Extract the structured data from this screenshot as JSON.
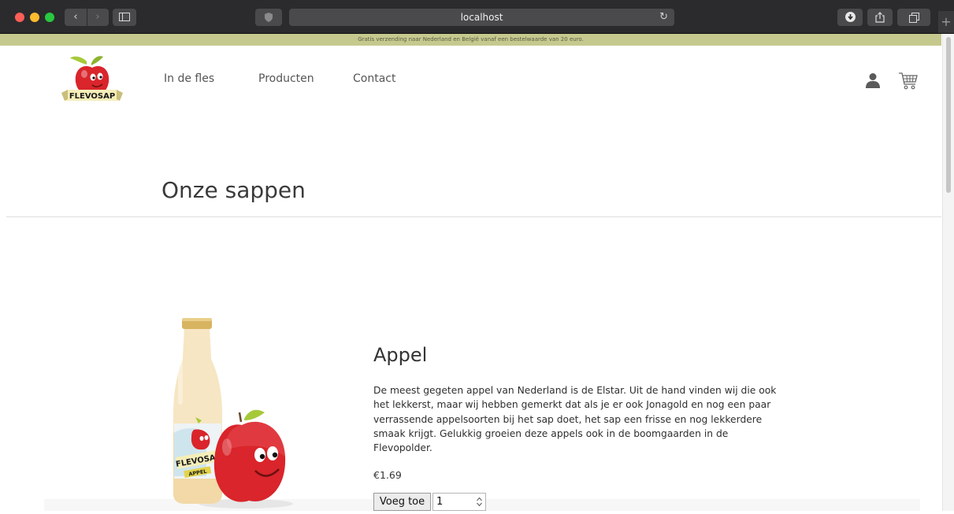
{
  "browser": {
    "url": "localhost",
    "colors": {
      "chrome_bg": "#2b2b2d",
      "close": "#fe5f57",
      "minimize": "#febc2e",
      "zoom": "#28c840"
    }
  },
  "announcement": {
    "text": "Gratis verzending naar Nederland en België vanaf een bestelwaarde van 20 euro.",
    "background": "#c5c98e"
  },
  "header": {
    "logo_text": "FLEVOSAP",
    "nav": [
      "In de fles",
      "Producten",
      "Contact"
    ],
    "icons": [
      "user-icon",
      "cart-icon"
    ]
  },
  "page": {
    "title": "Onze sappen"
  },
  "product": {
    "name": "Appel",
    "description": "De meest gegeten appel van Nederland is de Elstar. Uit de hand vinden wij die ook het lekkerst, maar wij hebben gemerkt dat als je er ook Jonagold en nog een paar verrassende appelsoorten bij het sap doet, het sap een frisse en nog lekkerdere smaak krijgt. Gelukkig groeien deze appels ook in de boomgaarden in de Flevopolder.",
    "price": "€1.69",
    "add_label": "Voeg toe",
    "quantity": "1",
    "bottle_label": "FLEVOSAP",
    "bottle_sublabel": "APPEL"
  }
}
